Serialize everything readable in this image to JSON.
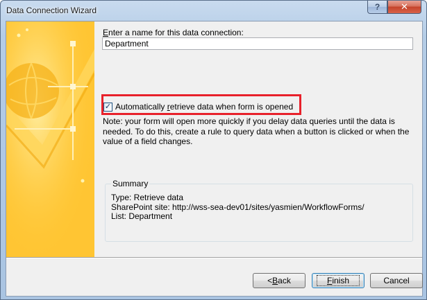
{
  "window": {
    "title": "Data Connection Wizard",
    "help_glyph": "?",
    "close_glyph": "✕"
  },
  "form": {
    "name_label_prefix": "",
    "name_label_ul": "E",
    "name_label_rest": "nter a name for this data connection:",
    "name_value": "Department",
    "checkbox_checked": true,
    "checkbox_label_pre": "Automatically ",
    "checkbox_label_ul": "r",
    "checkbox_label_post": "etrieve data when form is opened",
    "note": "Note: your form will open more quickly if you delay data queries until the data is needed. To do this, create a rule to query data when a button is clicked or when the value of a field changes."
  },
  "summary": {
    "title": "Summary",
    "type_line": "Type: Retrieve data",
    "site_line": "SharePoint site: http://wss-sea-dev01/sites/yasmien/WorkflowForms/",
    "list_line": "List: Department"
  },
  "buttons": {
    "back_prefix": "< ",
    "back_ul": "B",
    "back_rest": "ack",
    "finish_ul": "F",
    "finish_rest": "inish",
    "cancel": "Cancel"
  },
  "colors": {
    "highlight_border": "#e8212b",
    "banner_yellow": "#ffc42a",
    "client_bg": "#f0f0f0"
  }
}
